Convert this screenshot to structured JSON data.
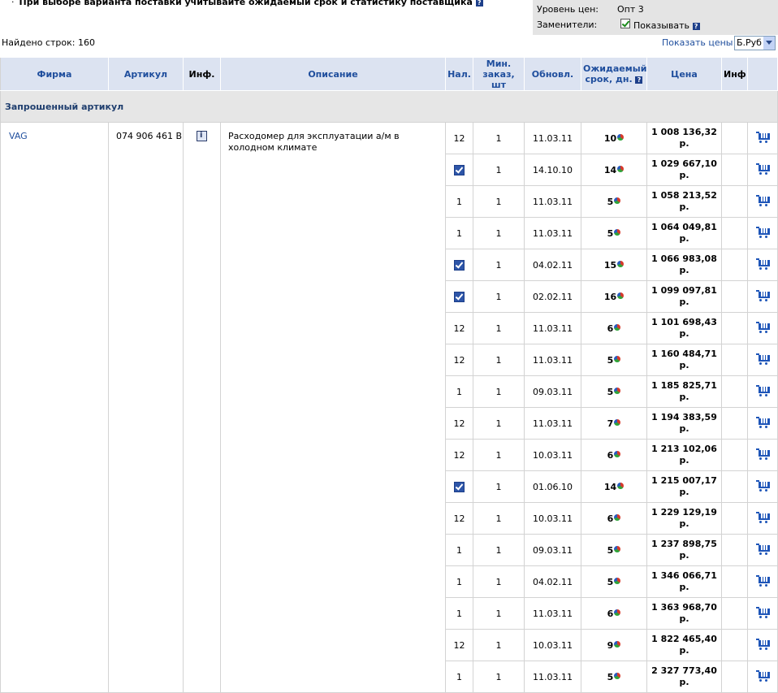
{
  "notice": "При выборе варианта поставки учитывайте ожидаемый срок и статистику поставщика",
  "panel": {
    "price_level_label": "Уровень цен:",
    "price_level_value": "Опт 3",
    "substitutes_label": "Заменители:",
    "show_label": "Показывать"
  },
  "found_rows": "Найдено строк: 160",
  "show_prices_label": "Показать цены в",
  "currency": "Б.Руб",
  "columns": {
    "firm": "Фирма",
    "article": "Артикул",
    "info": "Инф.",
    "description": "Описание",
    "stock": "Нал.",
    "min_order": "Мин. заказ, шт",
    "updated": "Обновл.",
    "expected_term": "Ожидаемый срок, дн.",
    "price": "Цена",
    "info2": "Инф"
  },
  "section_title": "Запрошенный артикул",
  "item": {
    "firm": "VAG",
    "article": "074 906 461 B",
    "description": "Расходомер для эксплуатации а/м в холодном климате"
  },
  "rows": [
    {
      "stock": "12",
      "stock_check": false,
      "min": "1",
      "updated": "11.03.11",
      "term": "10",
      "price": "1 008 136,32 р."
    },
    {
      "stock": "",
      "stock_check": true,
      "min": "1",
      "updated": "14.10.10",
      "term": "14",
      "price": "1 029 667,10 р."
    },
    {
      "stock": "1",
      "stock_check": false,
      "min": "1",
      "updated": "11.03.11",
      "term": "5",
      "price": "1 058 213,52 р."
    },
    {
      "stock": "1",
      "stock_check": false,
      "min": "1",
      "updated": "11.03.11",
      "term": "5",
      "price": "1 064 049,81 р."
    },
    {
      "stock": "",
      "stock_check": true,
      "min": "1",
      "updated": "04.02.11",
      "term": "15",
      "price": "1 066 983,08 р."
    },
    {
      "stock": "",
      "stock_check": true,
      "min": "1",
      "updated": "02.02.11",
      "term": "16",
      "price": "1 099 097,81 р."
    },
    {
      "stock": "12",
      "stock_check": false,
      "min": "1",
      "updated": "11.03.11",
      "term": "6",
      "price": "1 101 698,43 р."
    },
    {
      "stock": "12",
      "stock_check": false,
      "min": "1",
      "updated": "11.03.11",
      "term": "5",
      "price": "1 160 484,71 р."
    },
    {
      "stock": "1",
      "stock_check": false,
      "min": "1",
      "updated": "09.03.11",
      "term": "5",
      "price": "1 185 825,71 р."
    },
    {
      "stock": "12",
      "stock_check": false,
      "min": "1",
      "updated": "11.03.11",
      "term": "7",
      "price": "1 194 383,59 р."
    },
    {
      "stock": "12",
      "stock_check": false,
      "min": "1",
      "updated": "10.03.11",
      "term": "6",
      "price": "1 213 102,06 р."
    },
    {
      "stock": "",
      "stock_check": true,
      "min": "1",
      "updated": "01.06.10",
      "term": "14",
      "price": "1 215 007,17 р."
    },
    {
      "stock": "12",
      "stock_check": false,
      "min": "1",
      "updated": "10.03.11",
      "term": "6",
      "price": "1 229 129,19 р."
    },
    {
      "stock": "1",
      "stock_check": false,
      "min": "1",
      "updated": "09.03.11",
      "term": "5",
      "price": "1 237 898,75 р."
    },
    {
      "stock": "1",
      "stock_check": false,
      "min": "1",
      "updated": "04.02.11",
      "term": "5",
      "price": "1 346 066,71 р."
    },
    {
      "stock": "1",
      "stock_check": false,
      "min": "1",
      "updated": "11.03.11",
      "term": "6",
      "price": "1 363 968,70 р."
    },
    {
      "stock": "12",
      "stock_check": false,
      "min": "1",
      "updated": "10.03.11",
      "term": "9",
      "price": "1 822 465,40 р."
    },
    {
      "stock": "1",
      "stock_check": false,
      "min": "1",
      "updated": "11.03.11",
      "term": "5",
      "price": "2 327 773,40 р."
    }
  ]
}
